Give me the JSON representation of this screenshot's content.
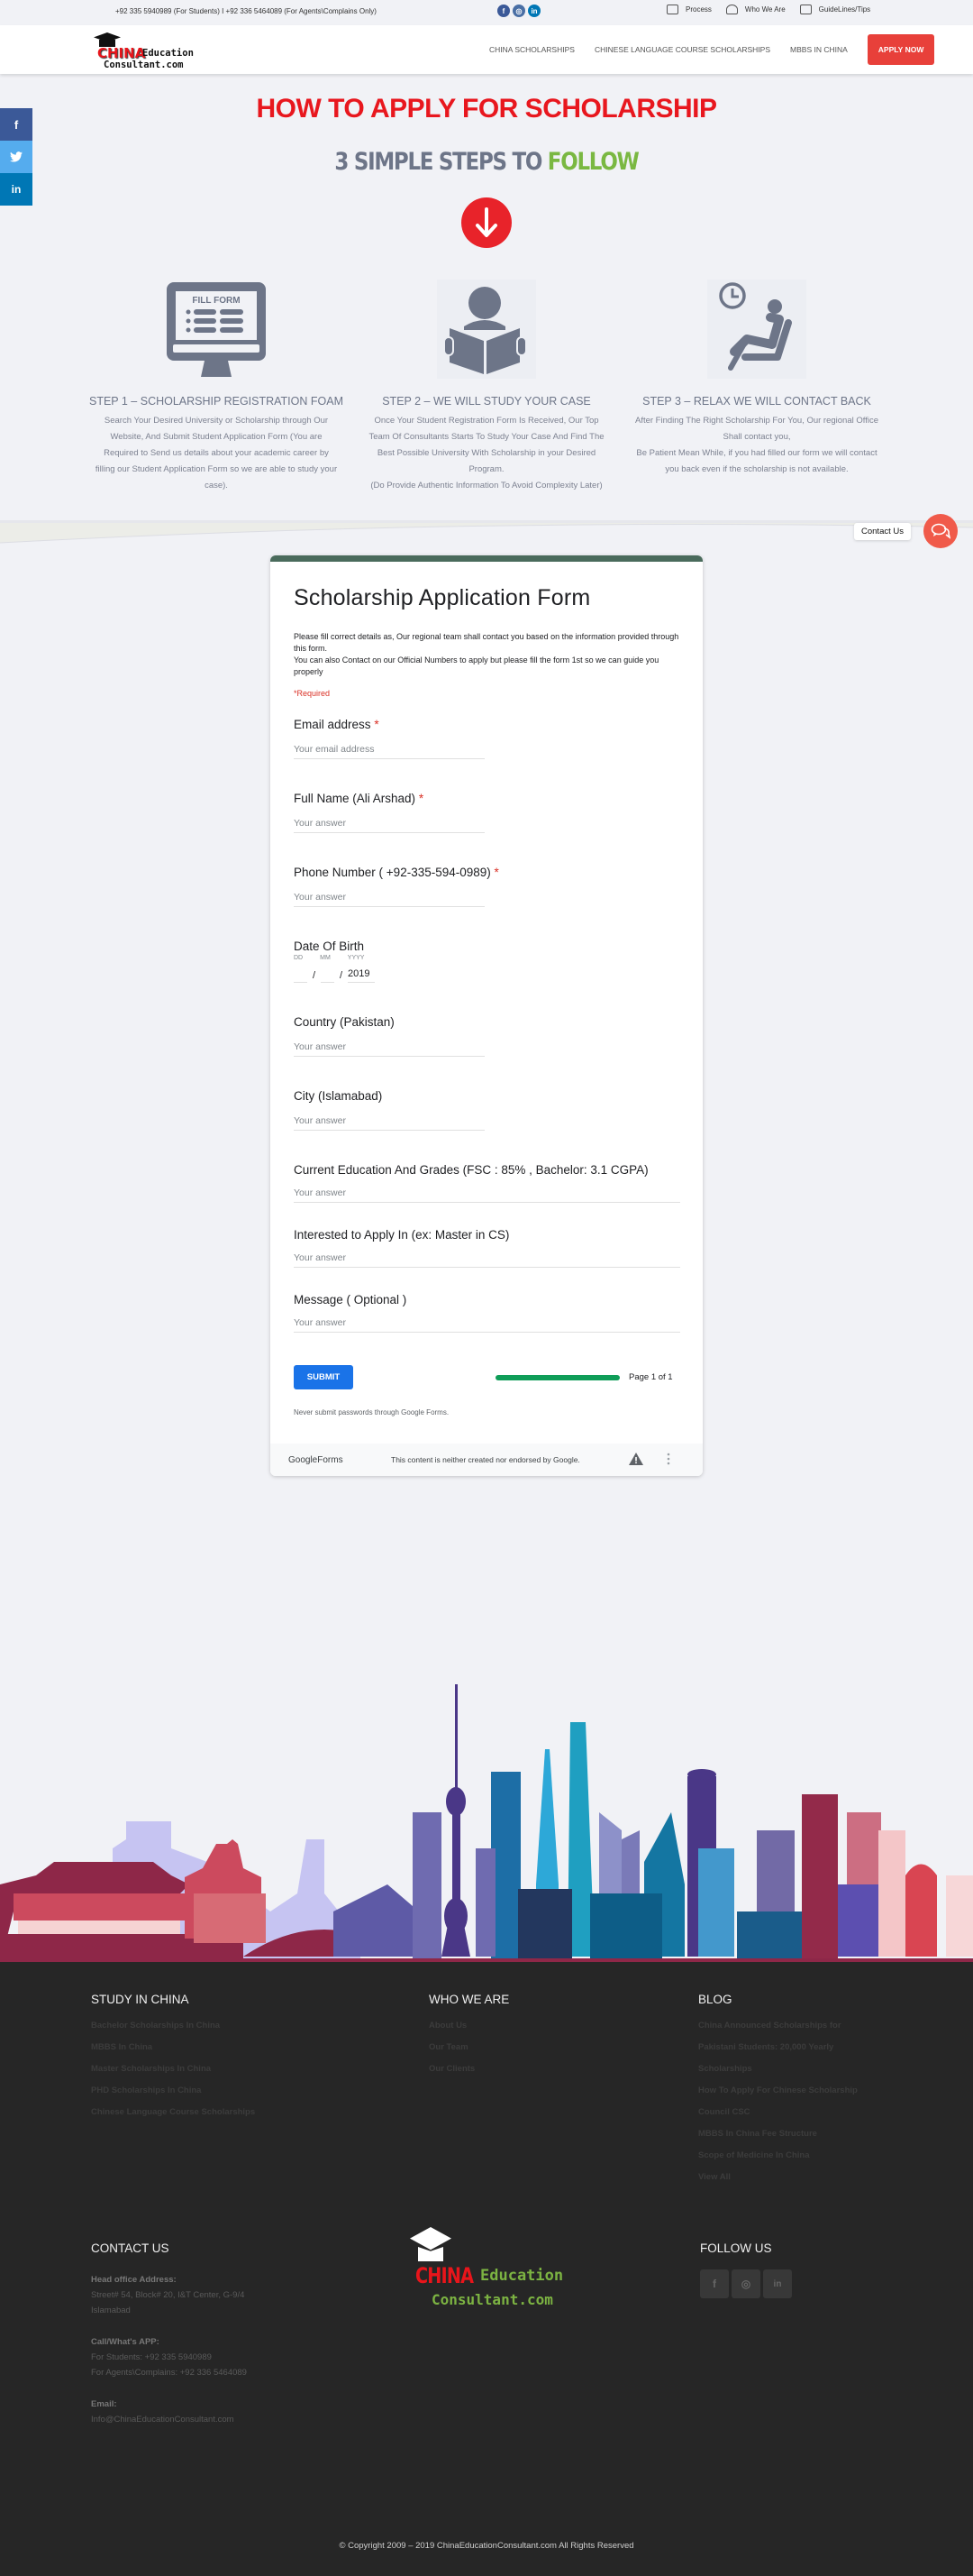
{
  "topbar": {
    "phones": "+92 335 5940989 (For Students) I +92 336 5464089 (For Agents\\Complains Only)",
    "social_icons": [
      "facebook-icon",
      "instagram-icon",
      "linkedin-icon"
    ],
    "links": [
      {
        "label": "Process",
        "icon": "process-icon"
      },
      {
        "label": "Who We Are",
        "icon": "team-icon"
      },
      {
        "label": "GuideLines/Tips",
        "icon": "guidelines-icon"
      }
    ]
  },
  "header": {
    "logo": {
      "china": "CHINA",
      "education": "Education",
      "consultant": "Consultant.com"
    },
    "nav": [
      "CHINA SCHOLARSHIPS",
      "CHINESE LANGUAGE COURSE SCHOLARSHIPS",
      "MBBS IN CHINA"
    ],
    "apply_label": "APPLY NOW"
  },
  "side_social": [
    {
      "icon": "facebook-icon",
      "glyph": "f",
      "color": "#3b5998"
    },
    {
      "icon": "twitter-icon",
      "glyph": "🐦",
      "color": "#55acee"
    },
    {
      "icon": "linkedin-icon",
      "glyph": "in",
      "color": "#0077b5"
    }
  ],
  "hero": {
    "title": "HOW TO APPLY FOR SCHOLARSHIP",
    "subtitle_main": "3 SIMPLE STEPS TO ",
    "subtitle_accent": "FOLLOW"
  },
  "steps": [
    {
      "title": "STEP 1 – SCHOLARSHIP REGISTRATION FOAM",
      "icon_text": "FILL FORM",
      "lines": [
        "Search Your Desired University or Scholarship through Our",
        "Website, And Submit Student Application Form (You are",
        "Required to Send us details about your academic career by",
        "filling our Student Application Form so we are able to study your",
        "case)."
      ]
    },
    {
      "title": "STEP 2 – WE WILL STUDY YOUR CASE",
      "lines": [
        "Once Your Student Registration Form Is Received, Our Top",
        "Team Of Consultants Starts To Study Your Case And Find The",
        "Best Possible University With Scholarship in your Desired",
        "Program.",
        "(Do Provide Authentic Information To Avoid Complexity Later)"
      ]
    },
    {
      "title": "STEP 3 – RELAX WE WILL CONTACT BACK",
      "lines": [
        "After Finding The Right Scholarship For You, Our regional Office",
        "Shall contact you,",
        "Be Patient Mean While, if you had filled our form we will contact",
        "you back even if the scholarship is not available."
      ]
    }
  ],
  "contact_float": {
    "label": "Contact Us"
  },
  "form": {
    "title": "Scholarship Application Form",
    "desc1": "Please fill correct details as, Our regional team shall contact you based on the information provided through this form.",
    "desc2": "You can also Contact on our Official Numbers to apply but please fill the form 1st so we can guide you properly",
    "required_note": "*Required",
    "questions": [
      {
        "label": "Email address",
        "required": true,
        "placeholder": "Your email address"
      },
      {
        "label": "Full Name (Ali Arshad)",
        "required": true,
        "placeholder": "Your answer"
      },
      {
        "label": "Phone Number ( +92-335-594-0989)",
        "required": true,
        "placeholder": "Your answer"
      },
      {
        "label": "Country (Pakistan)",
        "required": false,
        "placeholder": "Your answer"
      },
      {
        "label": "City (Islamabad)",
        "required": false,
        "placeholder": "Your answer"
      },
      {
        "label": "Current Education And Grades (FSC : 85% , Bachelor: 3.1 CGPA)",
        "required": false,
        "placeholder": "Your answer"
      },
      {
        "label": "Interested to Apply In (ex: Master in CS)",
        "required": false,
        "placeholder": "Your answer"
      },
      {
        "label": "Message ( Optional )",
        "required": false,
        "placeholder": "Your answer"
      }
    ],
    "dob": {
      "label": "Date Of Birth",
      "dd_label": "DD",
      "mm_label": "MM",
      "yyyy_label": "YYYY",
      "dd": "",
      "mm": "",
      "yyyy": "2019"
    },
    "submit_label": "SUBMIT",
    "progress_fraction": 1.0,
    "page_indicator": "Page 1 of 1",
    "never_note": "Never submit passwords through Google Forms.",
    "footer_brand": "GoogleForms",
    "footer_note": "This content is neither created nor endorsed by Google."
  },
  "footer": {
    "study": {
      "heading": "STUDY IN CHINA",
      "links": [
        "Bachelor Scholarships In China",
        "MBBS In China",
        "Master Scholarships In China",
        "PHD Scholarships In China",
        "Chinese Language Course Scholarships"
      ]
    },
    "who": {
      "heading": "WHO WE ARE",
      "links": [
        "About Us",
        "Our Team",
        "Our Clients"
      ]
    },
    "blog": {
      "heading": "BLOG",
      "links": [
        "China Announced Scholarships for",
        "Pakistani Students: 20,000 Yearly",
        "Scholarships",
        "How To Apply For Chinese Scholarship",
        "Council CSC",
        "MBBS In China Fee Structure",
        "Scope of Medicine In China",
        "View All"
      ]
    },
    "contact": {
      "heading": "CONTACT US",
      "address_label": "Head office Address:",
      "address_line1": "Street# 54, Block# 20, I&T Center, G-9/4",
      "address_line2": "Islamabad",
      "call_label": "Call/What's APP:",
      "students": "For Students: +92 335 5940989",
      "agents": "For Agents\\Complains: +92 336 5464089",
      "email_label": "Email:",
      "email": "Info@ChinaEducationConsultant.com"
    },
    "logo": {
      "china": "CHINA",
      "education": "Education",
      "consultant": "Consultant.com"
    },
    "follow": {
      "heading": "FOLLOW US",
      "icons": [
        "facebook-icon",
        "instagram-icon",
        "linkedin-icon"
      ]
    },
    "copyright": "© Copyright 2009 – 2019 ChinaEducationConsultant.com All Rights Reserved"
  }
}
